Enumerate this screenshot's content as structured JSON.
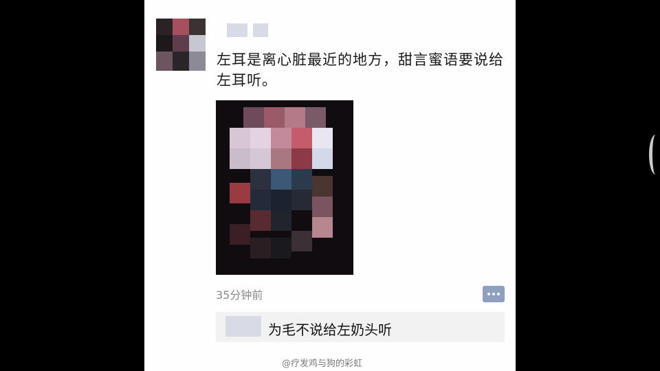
{
  "post": {
    "text": "左耳是离心脏最近的地方，甜言蜜语要说给左耳听。",
    "time": "35分钟前"
  },
  "comment": {
    "text": "为毛不说给左奶头听"
  },
  "watermark": "@疗发鸡与狗的彩虹",
  "icons": {
    "comment": "comment-bubble-icon"
  },
  "colors": {
    "background": "#000000",
    "panel": "#fefefe",
    "comment_bg": "#f2f2f2",
    "comment_icon": "#8f9fbf",
    "time_text": "#8a8a8a"
  }
}
